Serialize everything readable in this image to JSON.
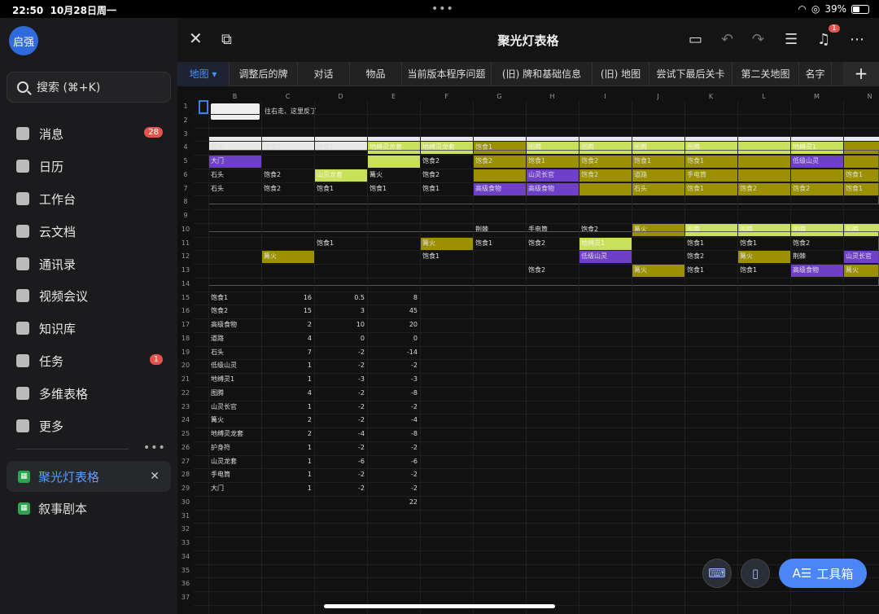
{
  "status": {
    "time": "22:50",
    "date": "10月28日周一",
    "battery": "39%"
  },
  "sidebar": {
    "avatar": "启强",
    "search": "搜索 (⌘+K)",
    "items": [
      {
        "label": "消息",
        "badge": "28"
      },
      {
        "label": "日历"
      },
      {
        "label": "工作台"
      },
      {
        "label": "云文档"
      },
      {
        "label": "通讯录"
      },
      {
        "label": "视频会议"
      },
      {
        "label": "知识库"
      },
      {
        "label": "任务",
        "badge": "1"
      },
      {
        "label": "多维表格"
      },
      {
        "label": "更多"
      }
    ],
    "docs": [
      {
        "label": "聚光灯表格"
      },
      {
        "label": "叙事剧本"
      }
    ]
  },
  "header": {
    "title": "聚光灯表格",
    "bell_badge": "1"
  },
  "tabs": [
    "地图",
    "调整后的牌",
    "对话",
    "物品",
    "当前版本程序问题",
    "(旧) 牌和基础信息",
    "(旧) 地图",
    "尝试下最后关卡",
    "第二关地图",
    "名字"
  ],
  "columns": [
    "B",
    "C",
    "D",
    "E",
    "F",
    "G",
    "H",
    "I",
    "J",
    "K",
    "L",
    "M",
    "N"
  ],
  "rows": [
    "1",
    "2",
    "3",
    "4",
    "5",
    "6",
    "7",
    "8",
    "9",
    "10",
    "11",
    "12",
    "13",
    "14",
    "15",
    "16",
    "17",
    "18",
    "19",
    "20",
    "21",
    "22",
    "23",
    "24",
    "25",
    "26",
    "27",
    "28",
    "29",
    "30",
    "31",
    "32",
    "33",
    "34",
    "35",
    "36",
    "37"
  ],
  "note": "往右走、这里反了",
  "colors": {
    "olive": "#9a9000",
    "lime": "#c9e05a",
    "purple": "#6f3fc8",
    "accent": "#4a86f5"
  },
  "grid_cells": [
    [
      "B4",
      "石头",
      ""
    ],
    [
      "C4",
      "饱食2",
      ""
    ],
    [
      "D4",
      "饱食1",
      ""
    ],
    [
      "E4",
      "地缚灵龙套",
      "lime"
    ],
    [
      "F4",
      "地缚灵龙套",
      "lime"
    ],
    [
      "G4",
      "饱食1",
      "olive"
    ],
    [
      "H4",
      "图腾",
      "lime"
    ],
    [
      "I4",
      "图腾",
      "lime"
    ],
    [
      "J4",
      "图腾",
      "lime"
    ],
    [
      "K4",
      "图腾",
      "lime"
    ],
    [
      "L4",
      "",
      "lime"
    ],
    [
      "M4",
      "地缚灵1",
      "lime"
    ],
    [
      "N4",
      "",
      "olive"
    ],
    [
      "B5",
      "大门",
      "purple"
    ],
    [
      "E5",
      "",
      "lime"
    ],
    [
      "F5",
      "饱食2",
      ""
    ],
    [
      "G5",
      "饱食2",
      "olive"
    ],
    [
      "H5",
      "饱食1",
      "olive"
    ],
    [
      "I5",
      "饱食2",
      "olive"
    ],
    [
      "J5",
      "饱食1",
      "olive"
    ],
    [
      "K5",
      "饱食1",
      "olive"
    ],
    [
      "L5",
      "",
      "olive"
    ],
    [
      "M5",
      "低级山灵",
      "purple"
    ],
    [
      "N5",
      "",
      "olive"
    ],
    [
      "B6",
      "石头",
      ""
    ],
    [
      "C6",
      "饱食2",
      ""
    ],
    [
      "D6",
      "山灵龙套",
      "lime"
    ],
    [
      "E6",
      "篝火",
      ""
    ],
    [
      "F6",
      "饱食2",
      ""
    ],
    [
      "G6",
      "",
      "olive"
    ],
    [
      "H6",
      "山灵长官",
      "purple"
    ],
    [
      "I6",
      "饱食2",
      "olive"
    ],
    [
      "J6",
      "道路",
      "olive"
    ],
    [
      "K6",
      "手电筒",
      "olive"
    ],
    [
      "L6",
      "",
      "olive"
    ],
    [
      "M6",
      "",
      "olive"
    ],
    [
      "N6",
      "饱食1",
      "olive"
    ],
    [
      "B7",
      "石头",
      ""
    ],
    [
      "C7",
      "饱食2",
      ""
    ],
    [
      "D7",
      "饱食1",
      ""
    ],
    [
      "E7",
      "饱食1",
      ""
    ],
    [
      "F7",
      "饱食1",
      ""
    ],
    [
      "G7",
      "高级食物",
      "purple"
    ],
    [
      "H7",
      "高级食物",
      "purple"
    ],
    [
      "I7",
      "",
      "olive"
    ],
    [
      "J7",
      "石头",
      "olive"
    ],
    [
      "K7",
      "饱食1",
      "olive"
    ],
    [
      "L7",
      "饱食2",
      "olive"
    ],
    [
      "M7",
      "饱食2",
      "olive"
    ],
    [
      "N7",
      "饱食1",
      "olive"
    ],
    [
      "G10",
      "荆棘",
      ""
    ],
    [
      "H10",
      "手电筒",
      ""
    ],
    [
      "I10",
      "饱食2",
      ""
    ],
    [
      "J10",
      "篝火",
      "olive"
    ],
    [
      "K10",
      "图腾",
      "lime"
    ],
    [
      "L10",
      "图腾",
      "lime"
    ],
    [
      "M10",
      "图腾",
      "lime"
    ],
    [
      "N10",
      "图腾",
      "lime"
    ],
    [
      "D11",
      "饱食1",
      ""
    ],
    [
      "F11",
      "篝火",
      "olive"
    ],
    [
      "G11",
      "饱食1",
      ""
    ],
    [
      "H11",
      "饱食2",
      ""
    ],
    [
      "I11",
      "地缚灵1",
      "lime"
    ],
    [
      "K11",
      "饱食1",
      ""
    ],
    [
      "L11",
      "饱食1",
      ""
    ],
    [
      "M11",
      "饱食2",
      ""
    ],
    [
      "C12",
      "篝火",
      "olive"
    ],
    [
      "F12",
      "饱食1",
      ""
    ],
    [
      "I12",
      "低级山灵",
      "purple"
    ],
    [
      "K12",
      "饱食2",
      ""
    ],
    [
      "L12",
      "篝火",
      "olive"
    ],
    [
      "M12",
      "荆棘",
      ""
    ],
    [
      "N12",
      "山灵长官",
      "purple"
    ],
    [
      "H13",
      "饱食2",
      ""
    ],
    [
      "J13",
      "篝火",
      "olive"
    ],
    [
      "K13",
      "饱食1",
      ""
    ],
    [
      "L13",
      "饱食1",
      ""
    ],
    [
      "M13",
      "高级食物",
      "purple"
    ],
    [
      "N13",
      "篝火",
      "olive"
    ]
  ],
  "table": [
    [
      "饱食1",
      "16",
      "0.5",
      "8"
    ],
    [
      "饱食2",
      "15",
      "3",
      "45"
    ],
    [
      "高级食物",
      "2",
      "10",
      "20"
    ],
    [
      "道路",
      "4",
      "0",
      "0"
    ],
    [
      "石头",
      "7",
      "-2",
      "-14"
    ],
    [
      "低级山灵",
      "1",
      "-2",
      "-2"
    ],
    [
      "地缚灵1",
      "1",
      "-3",
      "-3"
    ],
    [
      "图腾",
      "4",
      "-2",
      "-8"
    ],
    [
      "山灵长官",
      "1",
      "-2",
      "-2"
    ],
    [
      "篝火",
      "2",
      "-2",
      "-4"
    ],
    [
      "地缚灵龙套",
      "2",
      "-4",
      "-8"
    ],
    [
      "护身符",
      "1",
      "-2",
      "-2"
    ],
    [
      "山灵龙套",
      "1",
      "-6",
      "-6"
    ],
    [
      "手电筒",
      "1",
      "-2",
      "-2"
    ],
    [
      "大门",
      "1",
      "-2",
      "-2"
    ],
    [
      "",
      "",
      "",
      "22"
    ]
  ],
  "toolbox": "工具箱"
}
